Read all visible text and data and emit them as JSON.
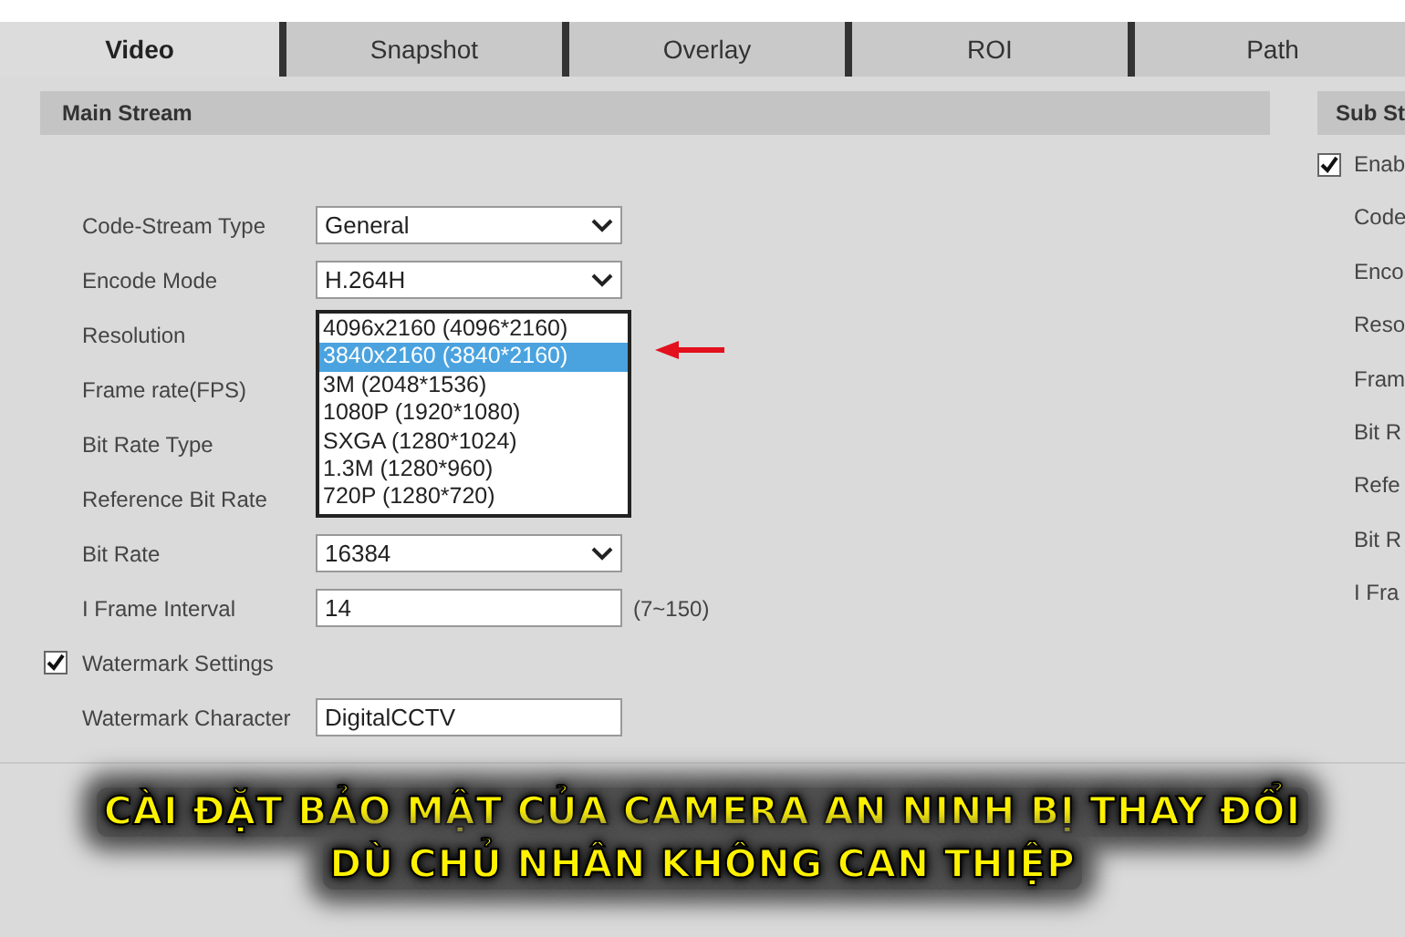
{
  "tabs": [
    {
      "label": "Video",
      "selected": true
    },
    {
      "label": "Snapshot",
      "selected": false
    },
    {
      "label": "Overlay",
      "selected": false
    },
    {
      "label": "ROI",
      "selected": false
    },
    {
      "label": "Path",
      "selected": false
    }
  ],
  "main_stream": {
    "title": "Main Stream",
    "fields": [
      {
        "kind": "select",
        "label": "Code-Stream Type",
        "value": "General"
      },
      {
        "kind": "select",
        "label": "Encode Mode",
        "value": "H.264H"
      },
      {
        "kind": "label",
        "label": "Resolution"
      },
      {
        "kind": "label",
        "label": "Frame rate(FPS)"
      },
      {
        "kind": "label",
        "label": "Bit Rate Type"
      },
      {
        "kind": "label",
        "label": "Reference Bit Rate"
      },
      {
        "kind": "select",
        "label": "Bit Rate",
        "value": "16384"
      },
      {
        "kind": "input",
        "label": "I Frame Interval",
        "value": "14",
        "hint": "(7~150)"
      },
      {
        "kind": "checkbox",
        "label": "Watermark Settings",
        "checked": true
      },
      {
        "kind": "input",
        "label": "Watermark Character",
        "value": "DigitalCCTV"
      }
    ]
  },
  "resolution_dropdown": {
    "options": [
      {
        "label": "4096x2160 (4096*2160)",
        "selected": false
      },
      {
        "label": "3840x2160 (3840*2160)",
        "selected": true
      },
      {
        "label": "3M (2048*1536)",
        "selected": false
      },
      {
        "label": "1080P (1920*1080)",
        "selected": false
      },
      {
        "label": "SXGA (1280*1024)",
        "selected": false
      },
      {
        "label": "1.3M (1280*960)",
        "selected": false
      },
      {
        "label": "720P (1280*720)",
        "selected": false
      }
    ]
  },
  "sub_stream": {
    "title": "Sub St",
    "enable": {
      "label": "Enab",
      "checked": true
    },
    "labels": [
      "Code",
      "Enco",
      "Reso",
      "Fram",
      "Bit R",
      "Refe",
      "Bit R",
      "I Fra"
    ]
  },
  "caption": [
    "CÀI ĐẶT BẢO MẬT CỦA CAMERA AN NINH BỊ THAY ĐỔI",
    "DÙ CHỦ NHÂN KHÔNG CAN THIỆP"
  ]
}
